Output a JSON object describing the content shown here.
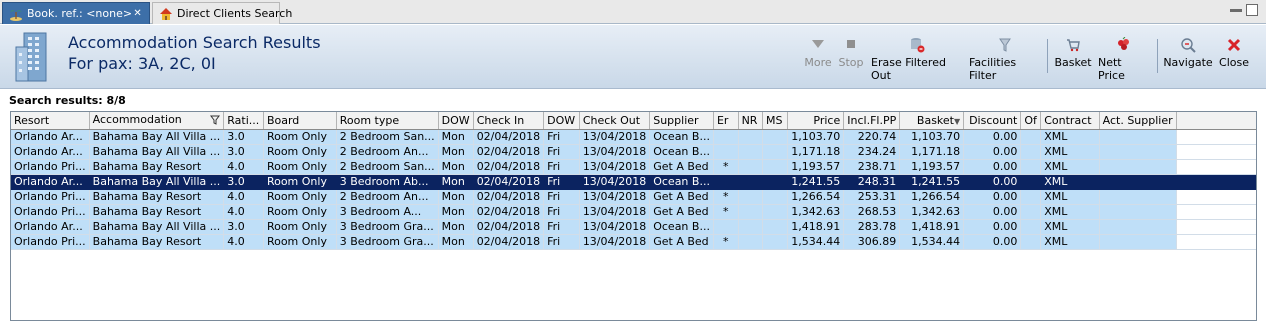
{
  "tabs": [
    {
      "label": "Book. ref.: <none>",
      "active": true,
      "icon": "palm-island-icon"
    },
    {
      "label": "Direct Clients Search",
      "active": false,
      "icon": "house-icon"
    }
  ],
  "header": {
    "title_line1": "Accommodation Search Results",
    "title_line2": "For pax: 3A, 2C, 0I",
    "icon": "hotel-building-icon"
  },
  "toolbar": {
    "more": "More",
    "stop": "Stop",
    "erase_filtered_out": "Erase Filtered Out",
    "facilities_filter": "Facilities Filter",
    "basket": "Basket",
    "nett_price": "Nett Price",
    "navigate": "Navigate",
    "close": "Close"
  },
  "results_label": "Search results: 8/8",
  "table": {
    "columns": [
      "Resort",
      "Accommodation",
      "Rati...",
      "Board",
      "Room type",
      "DOW",
      "Check In",
      "DOW",
      "Check Out",
      "Supplier",
      "Er",
      "NR",
      "MS",
      "Price",
      "Incl.Fl.PP",
      "Basket",
      "Discount",
      "Of",
      "Contract",
      "Act. Supplier"
    ],
    "selected_row": 3,
    "rows": [
      [
        "Orlando Ar...",
        "Bahama Bay All Villa ...",
        "3.0",
        "Room Only",
        "2 Bedroom San...",
        "Mon",
        "02/04/2018",
        "Fri",
        "13/04/2018",
        "Ocean B...",
        "",
        "",
        "",
        "1,103.70",
        "220.74",
        "1,103.70",
        "0.00",
        "",
        "XML",
        ""
      ],
      [
        "Orlando Ar...",
        "Bahama Bay All Villa ...",
        "3.0",
        "Room Only",
        "2 Bedroom An...",
        "Mon",
        "02/04/2018",
        "Fri",
        "13/04/2018",
        "Ocean B...",
        "",
        "",
        "",
        "1,171.18",
        "234.24",
        "1,171.18",
        "0.00",
        "",
        "XML",
        ""
      ],
      [
        "Orlando Pri...",
        "Bahama Bay Resort",
        "4.0",
        "Room Only",
        "2 Bedroom San...",
        "Mon",
        "02/04/2018",
        "Fri",
        "13/04/2018",
        "Get A Bed",
        "*",
        "",
        "",
        "1,193.57",
        "238.71",
        "1,193.57",
        "0.00",
        "",
        "XML",
        ""
      ],
      [
        "Orlando Ar...",
        "Bahama Bay All Villa ...",
        "3.0",
        "Room Only",
        "3 Bedroom Ab...",
        "Mon",
        "02/04/2018",
        "Fri",
        "13/04/2018",
        "Ocean B...",
        "",
        "",
        "",
        "1,241.55",
        "248.31",
        "1,241.55",
        "0.00",
        "",
        "XML",
        ""
      ],
      [
        "Orlando Pri...",
        "Bahama Bay Resort",
        "4.0",
        "Room Only",
        "2 Bedroom An...",
        "Mon",
        "02/04/2018",
        "Fri",
        "13/04/2018",
        "Get A Bed",
        "*",
        "",
        "",
        "1,266.54",
        "253.31",
        "1,266.54",
        "0.00",
        "",
        "XML",
        ""
      ],
      [
        "Orlando Pri...",
        "Bahama Bay Resort",
        "4.0",
        "Room Only",
        "3 Bedroom A...",
        "Mon",
        "02/04/2018",
        "Fri",
        "13/04/2018",
        "Get A Bed",
        "*",
        "",
        "",
        "1,342.63",
        "268.53",
        "1,342.63",
        "0.00",
        "",
        "XML",
        ""
      ],
      [
        "Orlando Ar...",
        "Bahama Bay All Villa ...",
        "3.0",
        "Room Only",
        "3 Bedroom Gra...",
        "Mon",
        "02/04/2018",
        "Fri",
        "13/04/2018",
        "Ocean B...",
        "",
        "",
        "",
        "1,418.91",
        "283.78",
        "1,418.91",
        "0.00",
        "",
        "XML",
        ""
      ],
      [
        "Orlando Pri...",
        "Bahama Bay Resort",
        "4.0",
        "Room Only",
        "3 Bedroom Gra...",
        "Mon",
        "02/04/2018",
        "Fri",
        "13/04/2018",
        "Get A Bed",
        "*",
        "",
        "",
        "1,534.44",
        "306.89",
        "1,534.44",
        "0.00",
        "",
        "XML",
        ""
      ]
    ]
  },
  "colors": {
    "row_bg": "#bfdff8",
    "selected_bg": "#0b2360",
    "title_color": "#0b2a66",
    "active_tab": "#3d6fa8"
  }
}
